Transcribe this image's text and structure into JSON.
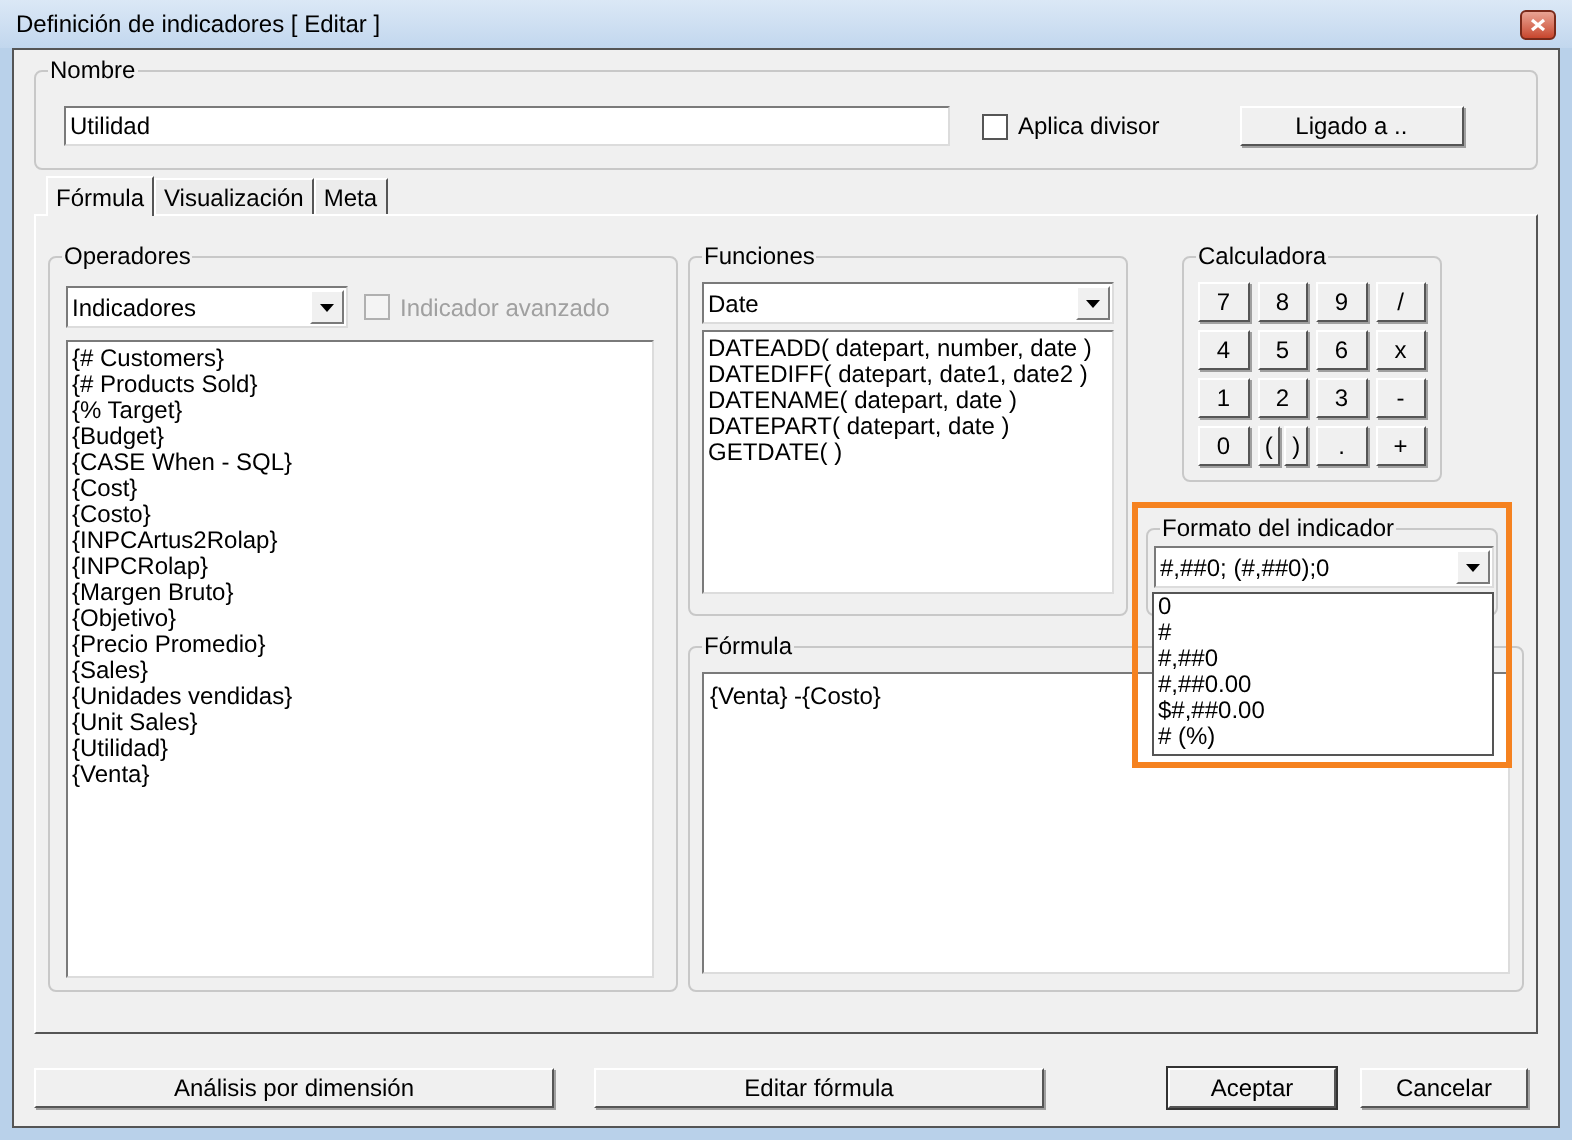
{
  "window": {
    "title": "Definición de indicadores [ Editar ]"
  },
  "nombre": {
    "label": "Nombre",
    "value": "Utilidad",
    "aplica_divisor": {
      "label": "Aplica divisor",
      "checked": false
    },
    "button": "Ligado a .."
  },
  "tabs": [
    {
      "label": "Fórmula",
      "selected": true
    },
    {
      "label": "Visualización",
      "selected": false
    },
    {
      "label": "Meta",
      "selected": false
    }
  ],
  "operadores": {
    "label": "Operadores",
    "combo": "Indicadores",
    "avanzado": {
      "label": "Indicador avanzado",
      "checked": false,
      "disabled": true
    },
    "items": [
      "{# Customers}",
      "{# Products Sold}",
      "{% Target}",
      "{Budget}",
      "{CASE When - SQL}",
      "{Cost}",
      "{Costo}",
      "{INPCArtus2Rolap}",
      "{INPCRolap}",
      "{Margen Bruto}",
      "{Objetivo}",
      "{Precio Promedio}",
      "{Sales}",
      "{Unidades vendidas}",
      "{Unit Sales}",
      "{Utilidad}",
      "{Venta}"
    ]
  },
  "funciones": {
    "label": "Funciones",
    "combo": "Date",
    "items": [
      "DATEADD( datepart, number, date )",
      "DATEDIFF( datepart, date1, date2 )",
      "DATENAME( datepart, date )",
      "DATEPART( datepart, date )",
      "GETDATE( )"
    ]
  },
  "calculadora": {
    "label": "Calculadora",
    "keys": [
      {
        "label": "7",
        "kind": "full"
      },
      {
        "label": "8",
        "kind": "full"
      },
      {
        "label": "9",
        "kind": "full"
      },
      {
        "label": "/",
        "kind": "full"
      },
      {
        "label": "4",
        "kind": "full"
      },
      {
        "label": "5",
        "kind": "full"
      },
      {
        "label": "6",
        "kind": "full"
      },
      {
        "label": "x",
        "kind": "full"
      },
      {
        "label": "1",
        "kind": "full"
      },
      {
        "label": "2",
        "kind": "full"
      },
      {
        "label": "3",
        "kind": "full"
      },
      {
        "label": "-",
        "kind": "full"
      },
      {
        "label": "0",
        "kind": "full"
      },
      {
        "label": "(",
        "kind": "half"
      },
      {
        "label": ")",
        "kind": "half"
      },
      {
        "label": ".",
        "kind": "full"
      },
      {
        "label": "+",
        "kind": "full"
      }
    ]
  },
  "formato": {
    "label": "Formato del indicador",
    "value": "#,##0; (#,##0);0",
    "options": [
      "0",
      "#",
      "#,##0",
      "#,##0.00",
      "$#,##0.00",
      "# (%)"
    ]
  },
  "formula": {
    "label": "Fórmula",
    "text": "{Venta} -{Costo}"
  },
  "buttons": [
    "Análisis por dimensión",
    "Editar fórmula",
    "Aceptar",
    "Cancelar"
  ]
}
